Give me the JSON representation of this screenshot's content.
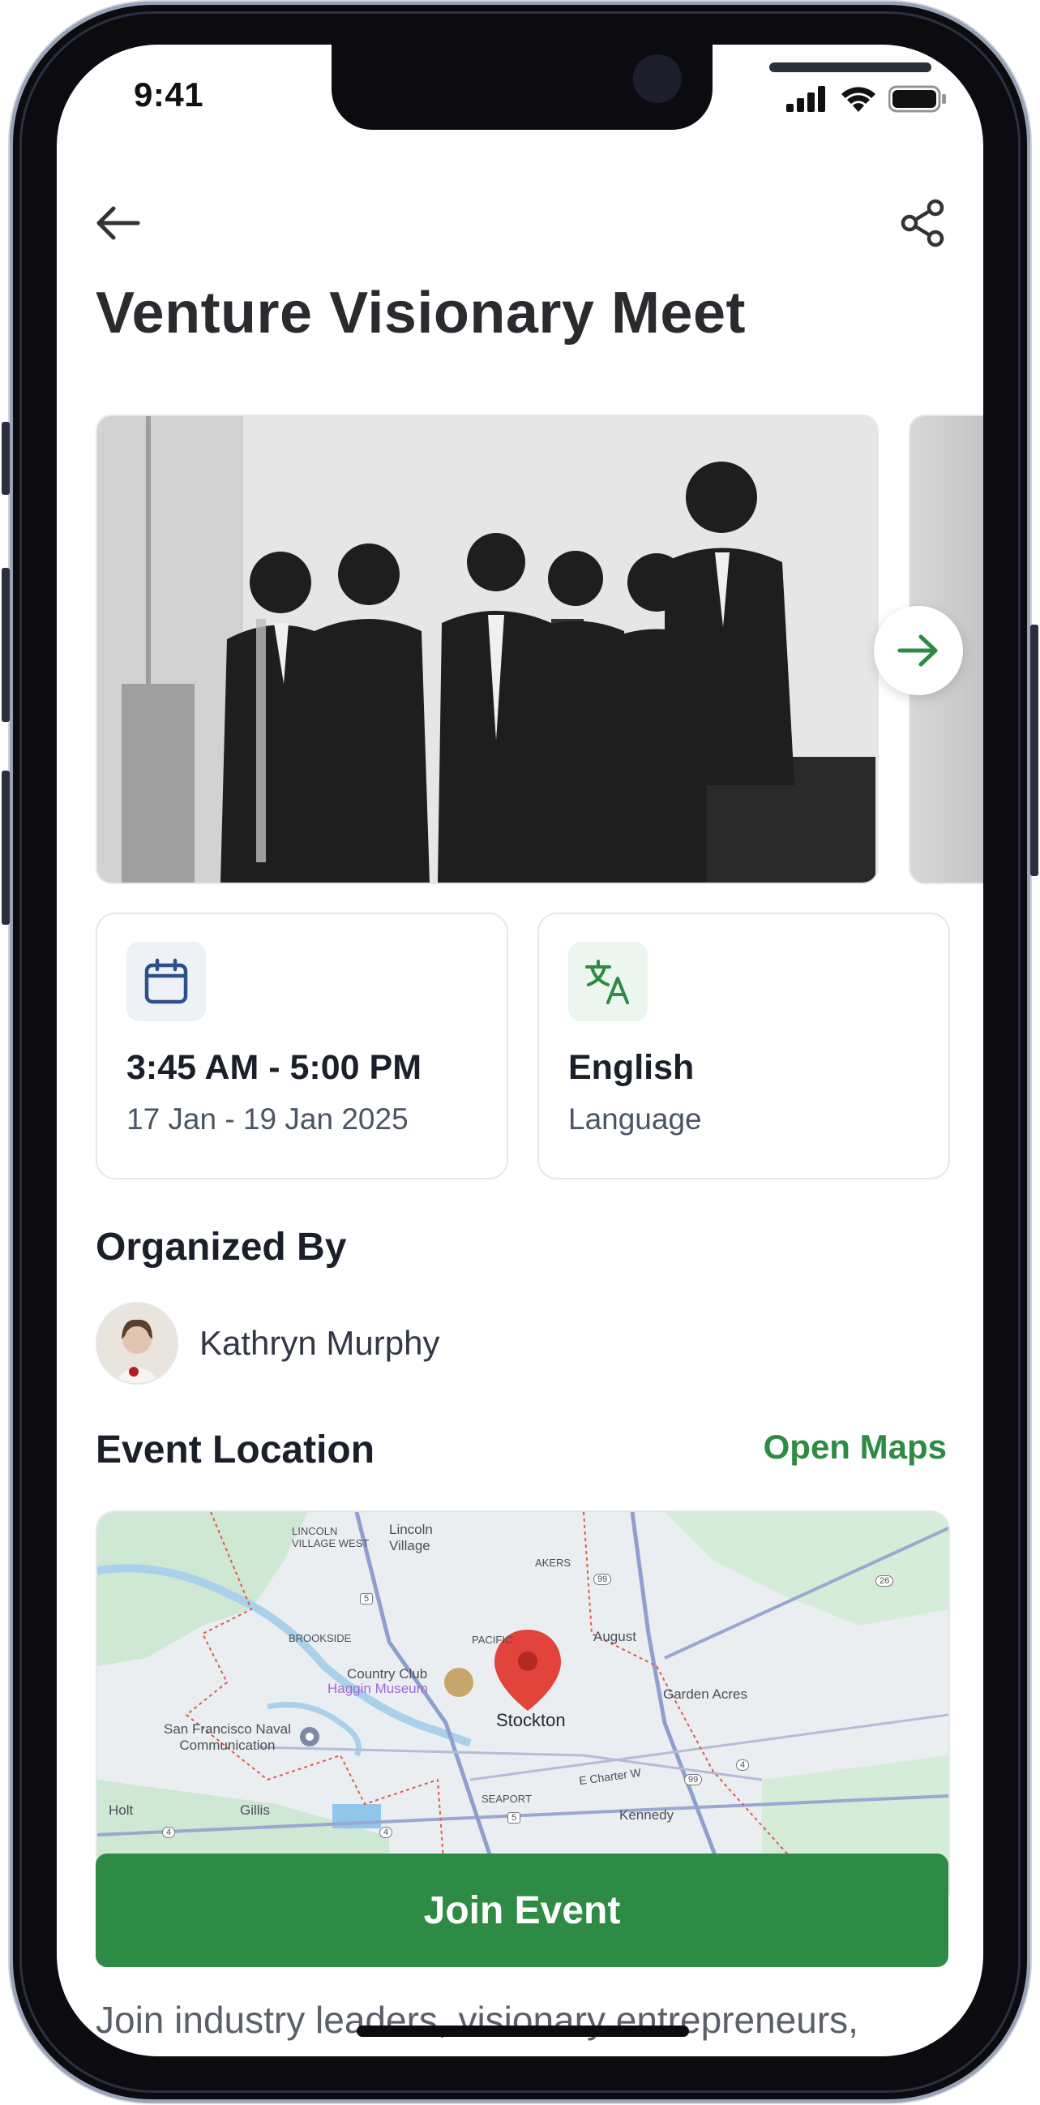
{
  "status_bar": {
    "time": "9:41"
  },
  "header": {
    "title": "Venture Visionary Meet"
  },
  "carousel": {
    "image_alt": "Group of businessmen in suits talking"
  },
  "info_cards": [
    {
      "main": "3:45 AM - 5:00 PM",
      "sub": "17 Jan - 19 Jan 2025",
      "icon": "calendar-icon"
    },
    {
      "main": "English",
      "sub": "Language",
      "icon": "translate-icon"
    }
  ],
  "organizer": {
    "heading": "Organized By",
    "name": "Kathryn Murphy"
  },
  "location": {
    "heading": "Event Location",
    "open_maps": "Open Maps",
    "map_labels": {
      "lincoln_village_west": "LINCOLN\nVILLAGE WEST",
      "lincoln_village": "Lincoln\nVillage",
      "akers": "AKERS",
      "brookside": "BROOKSIDE",
      "pacific": "PACIFIC",
      "august": "August",
      "country_club": "Country Club",
      "haggin_museum": "Haggin Museum",
      "stockton": "Stockton",
      "garden_acres": "Garden Acres",
      "sf_naval": "San Francisco Naval\nCommunication",
      "holt": "Holt",
      "gillis": "Gillis",
      "seaport": "SEAPORT",
      "kennedy": "Kennedy",
      "e_charter_way": "E Charter W",
      "route_99a": "99",
      "route_99b": "99",
      "route_26": "26",
      "route_4a": "4",
      "route_4b": "4",
      "route_4c": "4",
      "route_5a": "5",
      "route_5b": "5"
    }
  },
  "actions": {
    "join_event": "Join Event"
  },
  "description": "Join industry leaders, visionary entrepreneurs,",
  "colors": {
    "accent": "#2e8b45",
    "calendar_icon_bg": "#eef1f6",
    "translate_icon_bg": "#edf5ef"
  }
}
